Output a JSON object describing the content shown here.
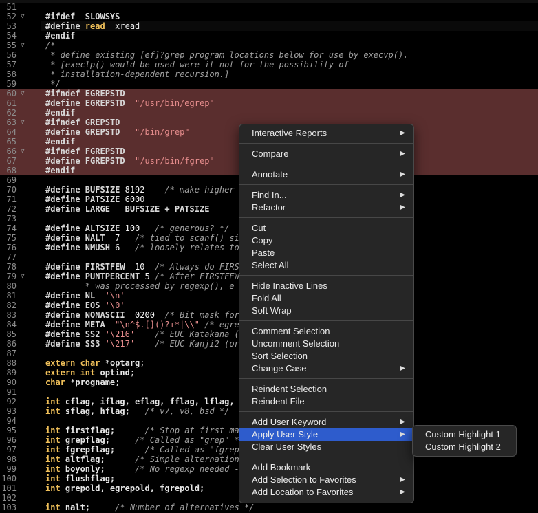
{
  "editor": {
    "lines": [
      {
        "n": "51",
        "fold": "",
        "parts": [
          {
            "t": "",
            "c": ""
          }
        ]
      },
      {
        "n": "52",
        "fold": "▽",
        "parts": [
          {
            "t": "#ifdef  SLOWSYS",
            "c": "pp"
          }
        ]
      },
      {
        "n": "53",
        "fold": "",
        "parts": [
          {
            "t": "#define ",
            "c": "pp"
          },
          {
            "t": "read",
            "c": "kw"
          },
          {
            "t": "  xread",
            "c": ""
          }
        ]
      },
      {
        "n": "54",
        "fold": "",
        "parts": [
          {
            "t": "#endif",
            "c": "pp"
          }
        ]
      },
      {
        "n": "55",
        "fold": "▽",
        "parts": [
          {
            "t": "/*",
            "c": "cmt"
          }
        ]
      },
      {
        "n": "56",
        "fold": "",
        "parts": [
          {
            "t": " * define existing [ef]?grep program locations below for use by execvp().",
            "c": "cmt"
          }
        ]
      },
      {
        "n": "57",
        "fold": "",
        "parts": [
          {
            "t": " * [execlp() would be used were it not for the possibility of",
            "c": "cmt"
          }
        ]
      },
      {
        "n": "58",
        "fold": "",
        "parts": [
          {
            "t": " * installation-dependent recursion.]",
            "c": "cmt"
          }
        ]
      },
      {
        "n": "59",
        "fold": "",
        "parts": [
          {
            "t": " */",
            "c": "cmt"
          }
        ]
      },
      {
        "n": "60",
        "fold": "▽",
        "parts": [
          {
            "t": "#ifndef EGREPSTD",
            "c": "pp"
          }
        ]
      },
      {
        "n": "61",
        "fold": "",
        "parts": [
          {
            "t": "#define EGREPSTD  ",
            "c": "pp"
          },
          {
            "t": "\"/usr/bin/egrep\"",
            "c": "str"
          }
        ]
      },
      {
        "n": "62",
        "fold": "",
        "parts": [
          {
            "t": "#endif",
            "c": "pp"
          }
        ]
      },
      {
        "n": "63",
        "fold": "▽",
        "parts": [
          {
            "t": "#ifndef GREPSTD",
            "c": "pp"
          }
        ]
      },
      {
        "n": "64",
        "fold": "",
        "parts": [
          {
            "t": "#define GREPSTD   ",
            "c": "pp"
          },
          {
            "t": "\"/bin/grep\"",
            "c": "str"
          }
        ]
      },
      {
        "n": "65",
        "fold": "",
        "parts": [
          {
            "t": "#endif",
            "c": "pp"
          }
        ]
      },
      {
        "n": "66",
        "fold": "▽",
        "parts": [
          {
            "t": "#ifndef FGREPSTD",
            "c": "pp"
          }
        ]
      },
      {
        "n": "67",
        "fold": "",
        "parts": [
          {
            "t": "#define FGREPSTD  ",
            "c": "pp"
          },
          {
            "t": "\"/usr/bin/fgrep\"",
            "c": "str"
          }
        ]
      },
      {
        "n": "68",
        "fold": "",
        "parts": [
          {
            "t": "#endif",
            "c": "pp"
          }
        ]
      },
      {
        "n": "69",
        "fold": "",
        "parts": [
          {
            "t": "",
            "c": ""
          }
        ]
      },
      {
        "n": "70",
        "fold": "",
        "parts": [
          {
            "t": "#define BUFSIZE ",
            "c": "pp"
          },
          {
            "t": "8192    ",
            "c": "num2"
          },
          {
            "t": "/* make higher",
            "c": "cmt"
          }
        ]
      },
      {
        "n": "71",
        "fold": "",
        "parts": [
          {
            "t": "#define PATSIZE ",
            "c": "pp"
          },
          {
            "t": "6000",
            "c": "num2"
          }
        ]
      },
      {
        "n": "72",
        "fold": "",
        "parts": [
          {
            "t": "#define LARGE   BUFSIZE + PATSIZE",
            "c": "pp"
          }
        ]
      },
      {
        "n": "73",
        "fold": "",
        "parts": [
          {
            "t": "",
            "c": ""
          }
        ]
      },
      {
        "n": "74",
        "fold": "",
        "parts": [
          {
            "t": "#define ALTSIZE ",
            "c": "pp"
          },
          {
            "t": "100   ",
            "c": "num2"
          },
          {
            "t": "/* generous? */",
            "c": "cmt"
          }
        ]
      },
      {
        "n": "75",
        "fold": "",
        "parts": [
          {
            "t": "#define NALT  ",
            "c": "pp"
          },
          {
            "t": "7   ",
            "c": "num2"
          },
          {
            "t": "/* tied to scanf() si",
            "c": "cmt"
          }
        ]
      },
      {
        "n": "76",
        "fold": "",
        "parts": [
          {
            "t": "#define NMUSH ",
            "c": "pp"
          },
          {
            "t": "6   ",
            "c": "num2"
          },
          {
            "t": "/* loosely relates to",
            "c": "cmt"
          }
        ]
      },
      {
        "n": "77",
        "fold": "",
        "parts": [
          {
            "t": "",
            "c": ""
          }
        ]
      },
      {
        "n": "78",
        "fold": "",
        "parts": [
          {
            "t": "#define FIRSTFEW  ",
            "c": "pp"
          },
          {
            "t": "10  ",
            "c": "num2"
          },
          {
            "t": "/* Always do FIRS",
            "c": "cmt"
          }
        ]
      },
      {
        "n": "79",
        "fold": "▽",
        "parts": [
          {
            "t": "#define PUNTPERCENT ",
            "c": "pp"
          },
          {
            "t": "5 ",
            "c": "num2"
          },
          {
            "t": "/* After FIRSTFEW",
            "c": "cmt"
          }
        ]
      },
      {
        "n": "80",
        "fold": "",
        "parts": [
          {
            "t": "        * was processed by regexp(), e",
            "c": "cmt"
          }
        ]
      },
      {
        "n": "81",
        "fold": "",
        "parts": [
          {
            "t": "#define NL  ",
            "c": "pp"
          },
          {
            "t": "'\\n'",
            "c": "str"
          }
        ]
      },
      {
        "n": "82",
        "fold": "",
        "parts": [
          {
            "t": "#define EOS ",
            "c": "pp"
          },
          {
            "t": "'\\0'",
            "c": "str"
          }
        ]
      },
      {
        "n": "83",
        "fold": "",
        "parts": [
          {
            "t": "#define NONASCII  ",
            "c": "pp"
          },
          {
            "t": "0200  ",
            "c": "num2"
          },
          {
            "t": "/* Bit mask for",
            "c": "cmt"
          }
        ]
      },
      {
        "n": "84",
        "fold": "",
        "parts": [
          {
            "t": "#define META  ",
            "c": "pp"
          },
          {
            "t": "\"\\n^$.[]()?+*|\\\\\"",
            "c": "str"
          },
          {
            "t": " /* egre",
            "c": "cmt"
          }
        ]
      },
      {
        "n": "85",
        "fold": "",
        "parts": [
          {
            "t": "#define SS2 ",
            "c": "pp"
          },
          {
            "t": "'\\216'",
            "c": "str"
          },
          {
            "t": "    /* EUC Katakana (",
            "c": "cmt"
          }
        ]
      },
      {
        "n": "86",
        "fold": "",
        "parts": [
          {
            "t": "#define SS3 ",
            "c": "pp"
          },
          {
            "t": "'\\217'",
            "c": "str"
          },
          {
            "t": "    /* EUC Kanji2 (or",
            "c": "cmt"
          }
        ]
      },
      {
        "n": "87",
        "fold": "",
        "parts": [
          {
            "t": "",
            "c": ""
          }
        ]
      },
      {
        "n": "88",
        "fold": "",
        "parts": [
          {
            "t": "extern char ",
            "c": "kw"
          },
          {
            "t": "*",
            "c": ""
          },
          {
            "t": "optarg",
            "c": "id"
          },
          {
            "t": ";",
            "c": ""
          }
        ]
      },
      {
        "n": "89",
        "fold": "",
        "parts": [
          {
            "t": "extern int ",
            "c": "kw"
          },
          {
            "t": "optind",
            "c": "id"
          },
          {
            "t": ";",
            "c": ""
          }
        ]
      },
      {
        "n": "90",
        "fold": "",
        "parts": [
          {
            "t": "char ",
            "c": "kw"
          },
          {
            "t": "*",
            "c": ""
          },
          {
            "t": "progname",
            "c": "id"
          },
          {
            "t": ";",
            "c": ""
          }
        ]
      },
      {
        "n": "91",
        "fold": "",
        "parts": [
          {
            "t": "",
            "c": ""
          }
        ]
      },
      {
        "n": "92",
        "fold": "",
        "parts": [
          {
            "t": "int ",
            "c": "kw"
          },
          {
            "t": "cflag, iflag, eflag, fflag, lflag,",
            "c": "id"
          }
        ]
      },
      {
        "n": "93",
        "fold": "",
        "parts": [
          {
            "t": "int ",
            "c": "kw"
          },
          {
            "t": "sflag, hflag;   ",
            "c": "id"
          },
          {
            "t": "/* v7, v8, bsd */",
            "c": "cmt"
          }
        ]
      },
      {
        "n": "94",
        "fold": "",
        "parts": [
          {
            "t": "",
            "c": ""
          }
        ]
      },
      {
        "n": "95",
        "fold": "",
        "parts": [
          {
            "t": "int ",
            "c": "kw"
          },
          {
            "t": "firstflag;      ",
            "c": "id"
          },
          {
            "t": "/* Stop at first ma",
            "c": "cmt"
          }
        ]
      },
      {
        "n": "96",
        "fold": "",
        "parts": [
          {
            "t": "int ",
            "c": "kw"
          },
          {
            "t": "grepflag;     ",
            "c": "id"
          },
          {
            "t": "/* Called as \"grep\" *",
            "c": "cmt"
          }
        ]
      },
      {
        "n": "97",
        "fold": "",
        "parts": [
          {
            "t": "int ",
            "c": "kw"
          },
          {
            "t": "fgrepflag;      ",
            "c": "id"
          },
          {
            "t": "/* Called as \"fgrep",
            "c": "cmt"
          }
        ]
      },
      {
        "n": "98",
        "fold": "",
        "parts": [
          {
            "t": "int ",
            "c": "kw"
          },
          {
            "t": "altflag;      ",
            "c": "id"
          },
          {
            "t": "/* Simple alternation",
            "c": "cmt"
          }
        ]
      },
      {
        "n": "99",
        "fold": "",
        "parts": [
          {
            "t": "int ",
            "c": "kw"
          },
          {
            "t": "boyonly;      ",
            "c": "id"
          },
          {
            "t": "/* No regexp needed -",
            "c": "cmt"
          }
        ]
      },
      {
        "n": "100",
        "fold": "",
        "parts": [
          {
            "t": "int ",
            "c": "kw"
          },
          {
            "t": "flushflag;",
            "c": "id"
          }
        ]
      },
      {
        "n": "101",
        "fold": "",
        "parts": [
          {
            "t": "int ",
            "c": "kw"
          },
          {
            "t": "grepold, egrepold, fgrepold;",
            "c": "id"
          }
        ]
      },
      {
        "n": "102",
        "fold": "",
        "parts": [
          {
            "t": "",
            "c": ""
          }
        ]
      },
      {
        "n": "103",
        "fold": "",
        "parts": [
          {
            "t": "int ",
            "c": "kw"
          },
          {
            "t": "nalt;     ",
            "c": "id"
          },
          {
            "t": "/* Number of alternatives */",
            "c": "cmt"
          }
        ]
      }
    ]
  },
  "context_menu": {
    "items": [
      {
        "label": "Interactive Reports",
        "submenu": true
      },
      {
        "sep": true
      },
      {
        "label": "Compare",
        "submenu": true
      },
      {
        "sep": true
      },
      {
        "label": "Annotate",
        "submenu": true
      },
      {
        "sep": true
      },
      {
        "label": "Find In...",
        "submenu": true
      },
      {
        "label": "Refactor",
        "submenu": true
      },
      {
        "sep": true
      },
      {
        "label": "Cut",
        "submenu": false
      },
      {
        "label": "Copy",
        "submenu": false
      },
      {
        "label": "Paste",
        "submenu": false
      },
      {
        "label": "Select All",
        "submenu": false
      },
      {
        "sep": true
      },
      {
        "label": "Hide Inactive Lines",
        "submenu": false
      },
      {
        "label": "Fold All",
        "submenu": false
      },
      {
        "label": "Soft Wrap",
        "submenu": false
      },
      {
        "sep": true
      },
      {
        "label": "Comment Selection",
        "submenu": false
      },
      {
        "label": "Uncomment Selection",
        "submenu": false
      },
      {
        "label": "Sort Selection",
        "submenu": false
      },
      {
        "label": "Change Case",
        "submenu": true
      },
      {
        "sep": true
      },
      {
        "label": "Reindent Selection",
        "submenu": false
      },
      {
        "label": "Reindent File",
        "submenu": false
      },
      {
        "sep": true
      },
      {
        "label": "Add User Keyword",
        "submenu": true
      },
      {
        "label": "Apply User Style",
        "submenu": true,
        "active": true
      },
      {
        "label": "Clear User Styles",
        "submenu": false
      },
      {
        "sep": true
      },
      {
        "label": "Add Bookmark",
        "submenu": false
      },
      {
        "label": "Add Selection to Favorites",
        "submenu": true
      },
      {
        "label": "Add Location to Favorites",
        "submenu": true
      }
    ],
    "arrow_glyph": "▶"
  },
  "submenu": {
    "items": [
      {
        "label": "Custom Highlight 1"
      },
      {
        "label": "Custom Highlight 2"
      }
    ]
  },
  "colors": {
    "highlight_block": "#5a2e2e",
    "menu_active": "#2e5ccc"
  }
}
